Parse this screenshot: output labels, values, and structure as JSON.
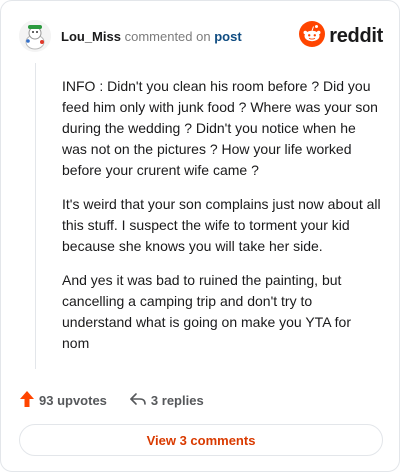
{
  "header": {
    "username": "Lou_Miss",
    "action_text": "commented on",
    "post_link": "post",
    "logo_text": "reddit"
  },
  "comment": {
    "paragraphs": [
      "INFO : Didn't you clean his room before ? Did you feed him only with junk food ? Where was your son during the wedding ? Didn't you notice when he was not on the pictures ? How your life worked before your crurent wife came ?",
      "It's weird that your son complains just now about all this stuff. I suspect the wife to torment your kid because she knows you will take her side.",
      "And yes it was bad to ruined the painting, but cancelling a camping trip and don't try to understand what is going on make you YTA for nom"
    ]
  },
  "actions": {
    "upvotes_label": "93 upvotes",
    "replies_label": "3 replies"
  },
  "footer": {
    "view_comments_label": "View 3 comments"
  },
  "colors": {
    "brand": "#ff4500",
    "link": "#0f4c81",
    "button_text": "#d93a00"
  },
  "icons": {
    "upvote": "upvote-arrow-icon",
    "reply": "reply-arrow-icon",
    "logo": "reddit-snoo-icon"
  }
}
